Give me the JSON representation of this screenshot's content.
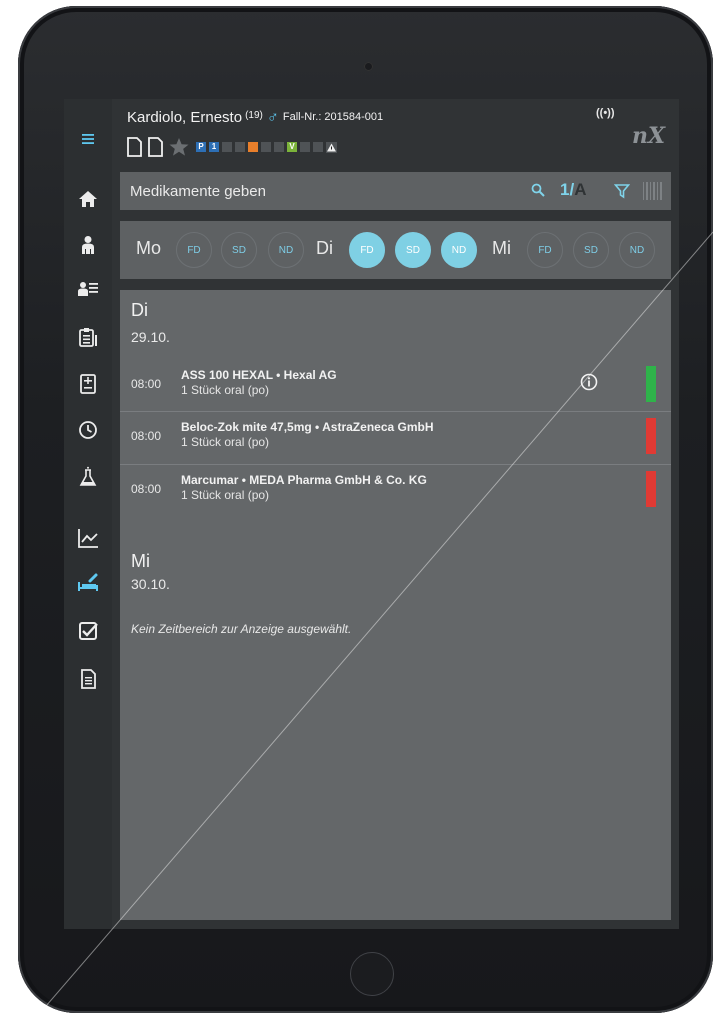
{
  "header": {
    "patient_name": "Kardiolo, Ernesto",
    "age": "(19)",
    "gender_symbol": "♂",
    "case_number": "Fall-Nr.: 201584-001",
    "status_p": "P",
    "status_1": "1",
    "status_v": "V",
    "logo": "nX",
    "signal": "((•))"
  },
  "toolbar": {
    "title": "Medikamente geben",
    "ratio_num": "1/",
    "ratio_letter": "A"
  },
  "shifts": {
    "days": [
      {
        "label": "Mo",
        "slots": [
          "FD",
          "SD",
          "ND"
        ]
      },
      {
        "label": "Di",
        "slots": [
          "FD",
          "SD",
          "ND"
        ]
      },
      {
        "label": "Mi",
        "slots": [
          "FD",
          "SD",
          "ND"
        ]
      }
    ],
    "active_day": "Di"
  },
  "schedule": {
    "day1": {
      "name": "Di",
      "date": "29.10.",
      "meds": [
        {
          "time": "08:00",
          "name": "ASS 100 HEXAL • Hexal AG",
          "dose": "1 Stück  oral (po)",
          "status_color": "#2fb34a",
          "has_info": true
        },
        {
          "time": "08:00",
          "name": "Beloc-Zok mite 47,5mg • AstraZeneca GmbH",
          "dose": "1 Stück  oral (po)",
          "status_color": "#e03a34",
          "has_info": false
        },
        {
          "time": "08:00",
          "name": "Marcumar • MEDA Pharma GmbH & Co. KG",
          "dose": "1 Stück  oral (po)",
          "status_color": "#e03a34",
          "has_info": false
        }
      ]
    },
    "day2": {
      "name": "Mi",
      "date": "30.10.",
      "empty_message": "Kein Zeitbereich zur Anzeige ausgewählt."
    }
  },
  "sidebar": {
    "items": [
      "menu-icon",
      "home-icon",
      "patient-icon",
      "patient-list-icon",
      "clipboard-icon",
      "calculator-icon",
      "clock-icon",
      "lab-flask-icon",
      "chart-icon",
      "medication-bed-icon",
      "checkbox-icon",
      "document-icon"
    ],
    "active": "medication-bed-icon",
    "accent": "#5ec8f0"
  }
}
